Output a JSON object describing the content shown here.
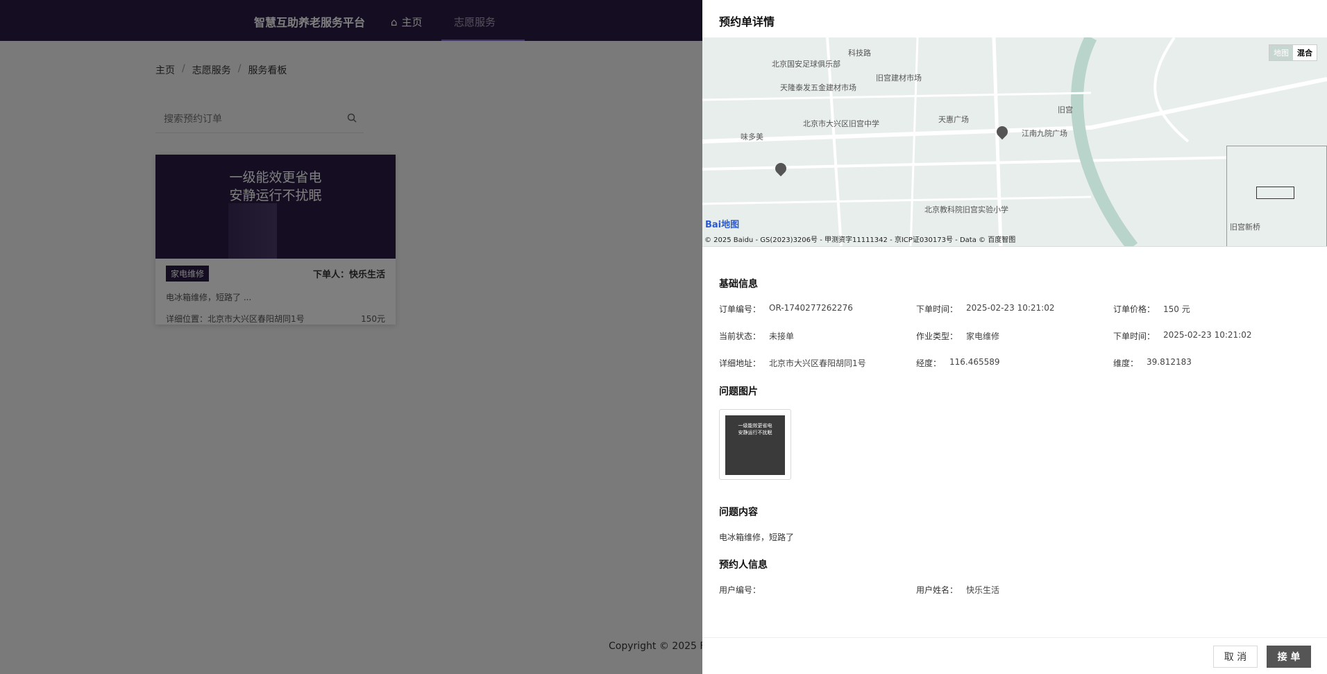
{
  "header": {
    "brand": "智慧互助养老服务平台",
    "nav": [
      {
        "label": "主页",
        "icon": "home-icon"
      },
      {
        "label": "志愿服务"
      }
    ]
  },
  "breadcrumb": [
    "主页",
    "志愿服务",
    "服务看板"
  ],
  "search": {
    "placeholder": "搜索预约订单"
  },
  "card": {
    "banner_line1": "一级能效更省电",
    "banner_line2": "安静运行不扰眠",
    "tag": "家电维修",
    "orderer": "下单人：快乐生活",
    "desc": "电冰箱维修，短路了 ...",
    "address": "详细位置：北京市大兴区春阳胡同1号",
    "price": "150元"
  },
  "footer": {
    "copyright": "Copyright © 2025 F"
  },
  "drawer": {
    "title": "预约单详情",
    "map": {
      "toggle": [
        "地图",
        "混合"
      ],
      "labels": [
        "科技路",
        "北京国安足球俱乐部",
        "旧宫建材市场",
        "天隆泰发五金建材市场",
        "北京市大兴区旧宫中学",
        "天惠广场",
        "旧宫",
        "江南九院广场",
        "味多美",
        "北京教科院旧宫实验小学",
        "旧宫新桥"
      ],
      "copyright": "© 2025 Baidu - GS(2023)3206号 - 甲测资字11111342 - 京ICP证030173号 - Data © 百度智图",
      "logo": "Bai地图"
    },
    "basic_title": "基础信息",
    "basic": [
      {
        "k": "订单编号：",
        "v": "OR-1740277262276"
      },
      {
        "k": "下单时间：",
        "v": "2025-02-23 10:21:02"
      },
      {
        "k": "订单价格：",
        "v": "150 元"
      },
      {
        "k": "当前状态：",
        "v": "未接单"
      },
      {
        "k": "作业类型：",
        "v": "家电维修"
      },
      {
        "k": "下单时间：",
        "v": "2025-02-23 10:21:02"
      },
      {
        "k": "详细地址：",
        "v": "北京市大兴区春阳胡同1号"
      },
      {
        "k": "经度：",
        "v": "116.465589"
      },
      {
        "k": "维度：",
        "v": "39.812183"
      }
    ],
    "images_title": "问题图片",
    "thumb_line1": "一级能效更省电",
    "thumb_line2": "安静运行不扰眠",
    "content_title": "问题内容",
    "content": "电冰箱维修，短路了",
    "person_title": "预约人信息",
    "person": [
      {
        "k": "用户编号：",
        "v": ""
      },
      {
        "k": "用户姓名：",
        "v": "快乐生活"
      }
    ],
    "cancel_label": "取 消",
    "accept_label": "接 单"
  }
}
